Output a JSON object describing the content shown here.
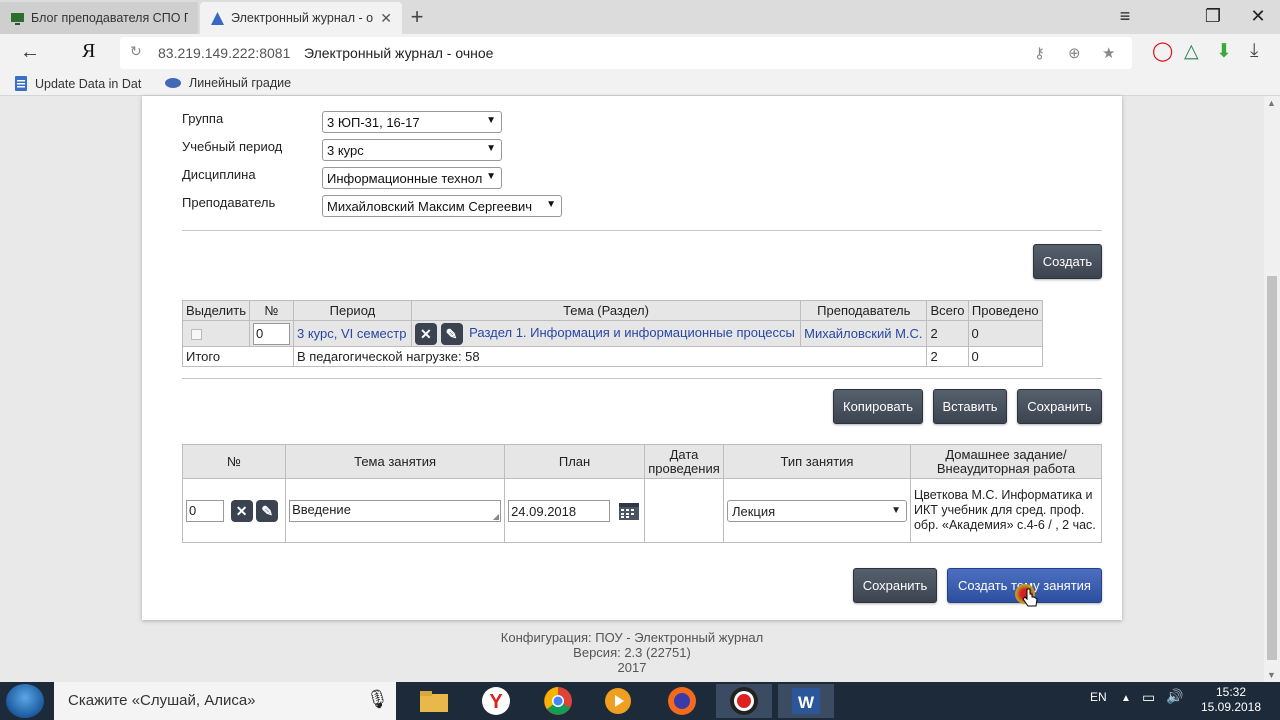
{
  "browser": {
    "tabs": [
      {
        "label": "Блог преподавателя СПО П"
      },
      {
        "label": "Электронный журнал - о"
      }
    ],
    "url_host": "83.219.149.222:8081",
    "url_title": "Электронный журнал - очное",
    "ya_label": "Я",
    "bookmarks": [
      {
        "label": "Update Data in Dat"
      },
      {
        "label": "Линейный градие"
      }
    ]
  },
  "filters": {
    "group_label": "Группа",
    "group_value": "3 ЮП-31, 16-17",
    "period_label": "Учебный период",
    "period_value": "3 курс",
    "discipline_label": "Дисциплина",
    "discipline_value": "Информационные технол",
    "teacher_label": "Преподаватель",
    "teacher_value": "Михайловский Максим Сергеевич"
  },
  "actions": {
    "create": "Создать",
    "copy": "Копировать",
    "paste": "Вставить",
    "save": "Сохранить",
    "save2": "Сохранить",
    "create_topic": "Создать тему занятия"
  },
  "topics_table": {
    "headers": [
      "Выделить",
      "№",
      "Период",
      "Тема (Раздел)",
      "Преподаватель",
      "Всего",
      "Проведено"
    ],
    "row": {
      "number": "0",
      "period": "3 курс, VI семестр",
      "topic": "Раздел 1. Информация и информационные процессы",
      "teacher": "Михайловский М.С.",
      "total": "2",
      "done": "0"
    },
    "totals": {
      "label": "Итого",
      "load": "В педагогической нагрузке: 58",
      "total": "2",
      "done": "0"
    }
  },
  "lessons_table": {
    "headers": {
      "num": "№",
      "topic": "Тема занятия",
      "plan": "План",
      "date": "Дата проведения",
      "type": "Тип занятия",
      "homework": "Домашнее задание/ Внеаудиторная работа"
    },
    "row": {
      "number": "0",
      "topic": "Введение",
      "plan_date": "24.09.2018",
      "type": "Лекция",
      "homework": "Цветкова М.С. Информатика и ИКТ учебник для сред. проф. обр. «Академия» с.4-6 / , 2 час."
    }
  },
  "footer": {
    "config": "Конфигурация: ПОУ - Электронный журнал",
    "version": "Версия: 2.3 (22751)",
    "year": "2017"
  },
  "taskbar": {
    "search_text": "Скажите «Слушай, Алиса»",
    "lang": "EN",
    "time": "15:32",
    "date": "15.09.2018"
  },
  "colors": {
    "button": "#3c4450",
    "button_primary": "#2d4f9e",
    "link": "#2747a6",
    "taskbar": "#1d2a3a"
  }
}
